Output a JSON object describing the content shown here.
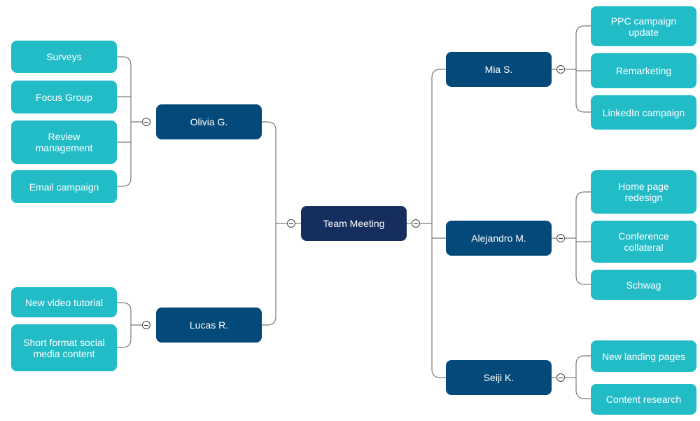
{
  "diagram": {
    "title": "Team Meeting",
    "colors": {
      "root": "#162e5e",
      "person": "#034a7a",
      "task": "#22bcc7",
      "connector": "#7a7a7a",
      "text": "#ffffff"
    },
    "root": {
      "label": "Team Meeting",
      "collapse_icon": "minus-circle-icon"
    },
    "branches": [
      {
        "name": "Olivia G.",
        "side": "left",
        "collapse_icon": "minus-circle-icon",
        "tasks": [
          "Surveys",
          "Focus Group",
          "Review management",
          "Email campaign"
        ]
      },
      {
        "name": "Lucas R.",
        "side": "left",
        "collapse_icon": "minus-circle-icon",
        "tasks": [
          "New video tutorial",
          "Short format social media content"
        ]
      },
      {
        "name": "Mia S.",
        "side": "right",
        "collapse_icon": "minus-circle-icon",
        "tasks": [
          "PPC campaign update",
          "Remarketing",
          "LinkedIn campaign"
        ]
      },
      {
        "name": "Alejandro M.",
        "side": "right",
        "collapse_icon": "minus-circle-icon",
        "tasks": [
          "Home page redesign",
          "Conference collateral",
          "Schwag"
        ]
      },
      {
        "name": "Seiji K.",
        "side": "right",
        "collapse_icon": "minus-circle-icon",
        "tasks": [
          "New landing pages",
          "Content research"
        ]
      }
    ]
  }
}
